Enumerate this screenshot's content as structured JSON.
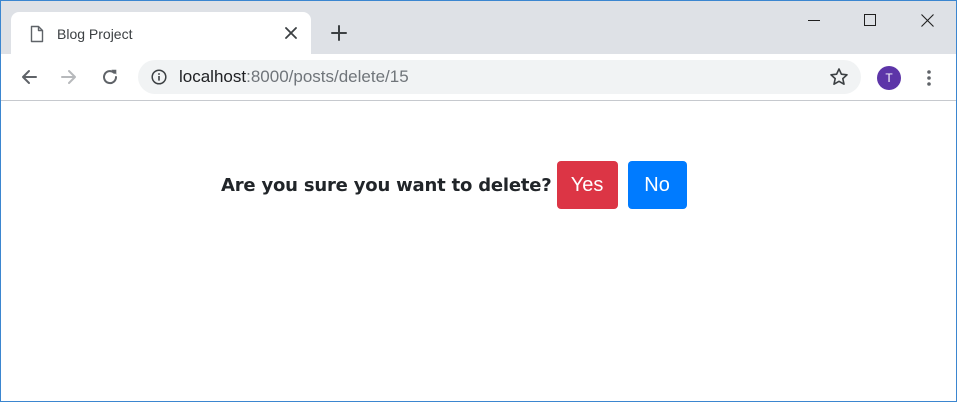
{
  "browser": {
    "tab": {
      "title": "Blog Project",
      "favicon": "page-icon"
    },
    "new_tab_icon": "plus-icon",
    "window_controls": [
      "minimize-icon",
      "maximize-icon",
      "close-icon"
    ],
    "address": {
      "host": "localhost",
      "path": ":8000/posts/delete/15",
      "security_icon": "info-icon",
      "bookmark_icon": "star-icon"
    },
    "profile_initial": "T",
    "colors": {
      "tabstrip": "#dee1e6",
      "omnibox": "#f1f3f4",
      "avatar": "#5d35a8"
    }
  },
  "page": {
    "confirm_text": "Are you sure you want to delete?",
    "yes_label": "Yes",
    "no_label": "No",
    "colors": {
      "yes": "#dc3545",
      "no": "#007bff"
    }
  }
}
